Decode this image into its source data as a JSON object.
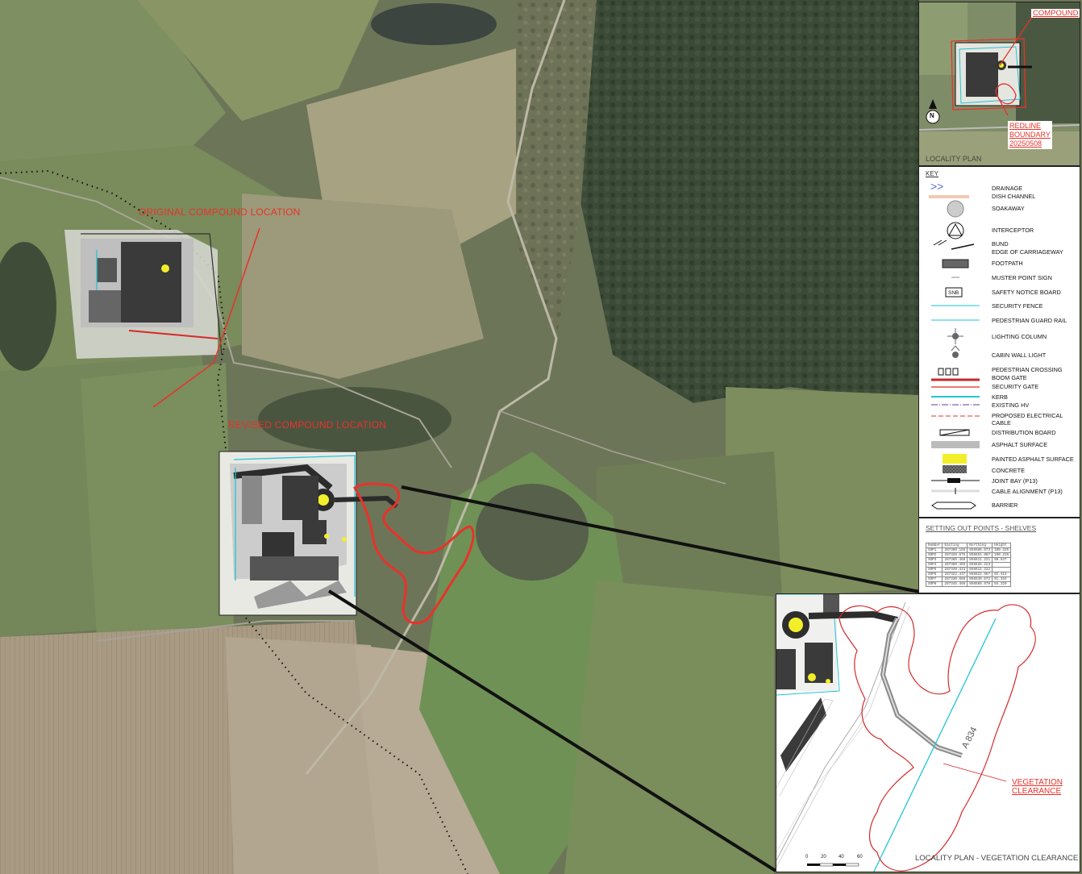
{
  "annotations": {
    "original_compound": "ORIGINAL COMPOUND LOCATION",
    "revised_compound": "REVISED COMPOUND LOCATION"
  },
  "inset_locality": {
    "compound_label": "COMPOUND",
    "redline_lines": [
      "REDLINE",
      "BOUNDARY",
      "20250508"
    ],
    "caption": "LOCALITY PLAN",
    "north_label": "N"
  },
  "key": {
    "title": "KEY",
    "items": [
      {
        "label": "DRAINAGE",
        "symbol": "drainage-chevrons"
      },
      {
        "label": "DISH CHANNEL",
        "symbol": "dish-channel"
      },
      {
        "label": "SOAKAWAY",
        "symbol": "soakaway-circle"
      },
      {
        "label": "INTERCEPTOR",
        "symbol": "interceptor-circle"
      },
      {
        "label": "BUND",
        "symbol": "bund-hatch"
      },
      {
        "label": "EDGE OF CARRIAGEWAY",
        "symbol": "carriageway-edge"
      },
      {
        "label": "FOOTPATH",
        "symbol": "footpath-bar"
      },
      {
        "label": "MUSTER POINT SIGN",
        "symbol": "muster-sign"
      },
      {
        "label": "SAFETY NOTICE BOARD",
        "symbol": "snb-box"
      },
      {
        "label": "SECURITY FENCE",
        "symbol": "security-fence-line"
      },
      {
        "label": "PEDESTRIAN GUARD RAIL",
        "symbol": "guard-rail-line"
      },
      {
        "label": "LIGHTING COLUMN",
        "symbol": "lighting-column"
      },
      {
        "label": "CABIN WALL LIGHT",
        "symbol": "cabin-wall-light"
      },
      {
        "label": "PEDESTRIAN CROSSING",
        "symbol": "pedestrian-crossing"
      },
      {
        "label": "BOOM GATE",
        "symbol": "boom-gate"
      },
      {
        "label": "SECURITY GATE",
        "symbol": "security-gate"
      },
      {
        "label": "KERB",
        "symbol": "kerb-line"
      },
      {
        "label": "EXISTING HV",
        "symbol": "existing-hv"
      },
      {
        "label": "PROPOSED ELECTRICAL",
        "symbol": "proposed-electrical"
      },
      {
        "label": "CABLE",
        "symbol": "none"
      },
      {
        "label": "DISTRIBUTION BOARD",
        "symbol": "distribution-board"
      },
      {
        "label": "ASPHALT SURFACE",
        "symbol": "asphalt-surface"
      },
      {
        "label": "PAINTED ASPHALT SURFACE",
        "symbol": "painted-asphalt"
      },
      {
        "label": "CONCRETE",
        "symbol": "concrete"
      },
      {
        "label": "JOINT BAY (P13)",
        "symbol": "joint-bay"
      },
      {
        "label": "CABLE ALIGNMENT (P13)",
        "symbol": "cable-alignment"
      },
      {
        "label": "BARRIER",
        "symbol": "barrier"
      }
    ],
    "snb_text": "SNB"
  },
  "setting_out": {
    "title": "SETTING OUT POINTS - SHELVES",
    "headers": [
      "Number",
      "Easting",
      "Northing",
      "Height"
    ],
    "rows": [
      [
        "SOP1",
        "287300.165",
        "856586.673",
        "100.325"
      ],
      [
        "SOP2",
        "287326.675",
        "856651.887",
        "100.226"
      ],
      [
        "SOP3",
        "287360.466",
        "856611.221",
        "99.847"
      ],
      [
        "SOP4",
        "287380.465",
        "856626.223",
        ""
      ],
      [
        "SOP5",
        "287349.431",
        "856611.222",
        ""
      ],
      [
        "SOP6",
        "287322.437",
        "856624.667",
        "92.414"
      ],
      [
        "SOP7",
        "287330.666",
        "856549.672",
        "91.334"
      ],
      [
        "SOP8",
        "287345.466",
        "856568.679",
        "94.320"
      ]
    ]
  },
  "inset_vegetation": {
    "road_label": "A 834",
    "vegetation_lines": [
      "VEGETATION",
      "CLEARANCE"
    ],
    "caption": "LOCALITY PLAN - VEGETATION CLEARANCE",
    "scale_ticks": [
      "0",
      "20",
      "40",
      "60"
    ]
  },
  "colors": {
    "annotation_red": "#e8322a",
    "cyan_kerb": "#22c4d6",
    "asphalt_dark": "#3c3c3c",
    "painted_yellow": "#f2ef2a",
    "key_blue": "#5a6bd8"
  }
}
